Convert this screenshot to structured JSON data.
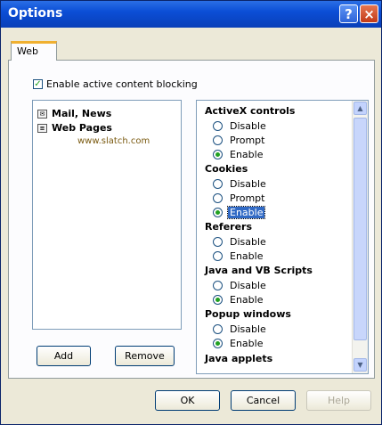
{
  "window": {
    "title": "Options",
    "help_label": "?",
    "close_label": "×"
  },
  "tab": {
    "label": "Web"
  },
  "blocking": {
    "label": "Enable active content blocking",
    "checked": true
  },
  "tree": {
    "items": [
      {
        "label": "Mail, News",
        "icon": "mail-icon"
      },
      {
        "label": "Web Pages",
        "icon": "page-icon"
      }
    ],
    "subitem": "www.slatch.com"
  },
  "buttons": {
    "add": "Add",
    "remove": "Remove",
    "ok": "OK",
    "cancel": "Cancel",
    "help": "Help"
  },
  "options": {
    "activex": {
      "title": "ActiveX controls",
      "disable": "Disable",
      "prompt": "Prompt",
      "enable": "Enable",
      "selected": "Enable"
    },
    "cookies": {
      "title": "Cookies",
      "disable": "Disable",
      "prompt": "Prompt",
      "enable": "Enable",
      "selected": "Enable"
    },
    "referers": {
      "title": "Referers",
      "disable": "Disable",
      "enable": "Enable",
      "selected": ""
    },
    "scripts": {
      "title": "Java and VB Scripts",
      "disable": "Disable",
      "enable": "Enable",
      "selected": "Enable"
    },
    "popups": {
      "title": "Popup windows",
      "disable": "Disable",
      "enable": "Enable",
      "selected": "Enable"
    },
    "applets": {
      "title": "Java applets"
    }
  }
}
